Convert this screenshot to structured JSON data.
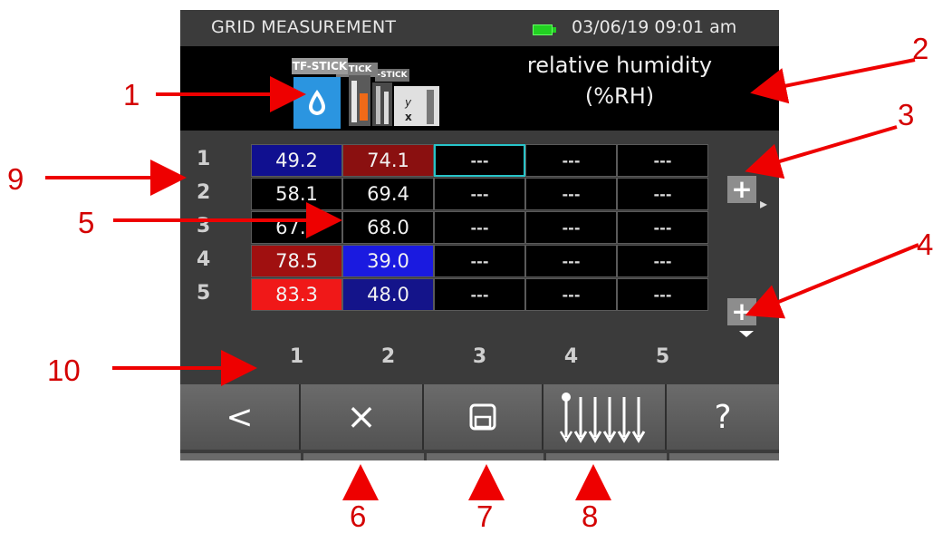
{
  "status_bar": {
    "title": "GRID MEASUREMENT",
    "datetime": "03/06/19 09:01 am",
    "battery_color": "#22d022"
  },
  "header": {
    "tabs": [
      "TF-STICK",
      "STICK",
      "-STICK"
    ],
    "measurement_title": "relative humidity",
    "measurement_unit": "(%RH)",
    "drop_color": "#2b95e0"
  },
  "grid": {
    "row_labels": [
      "1",
      "2",
      "3",
      "4",
      "5"
    ],
    "column_labels": [
      "1",
      "2",
      "3",
      "4",
      "5"
    ],
    "cells": [
      [
        "49.2",
        "74.1",
        "---",
        "---",
        "---"
      ],
      [
        "58.1",
        "69.4",
        "---",
        "---",
        "---"
      ],
      [
        "67.8",
        "68.0",
        "---",
        "---",
        "---"
      ],
      [
        "78.5",
        "39.0",
        "---",
        "---",
        "---"
      ],
      [
        "83.3",
        "48.0",
        "---",
        "---",
        "---"
      ]
    ],
    "plus_label": "+"
  },
  "toolbar": {
    "back": "<",
    "delete": "×",
    "help": "?"
  },
  "callouts": [
    "1",
    "2",
    "3",
    "4",
    "5",
    "6",
    "7",
    "8",
    "9",
    "10"
  ],
  "callout_color": "#d40000"
}
